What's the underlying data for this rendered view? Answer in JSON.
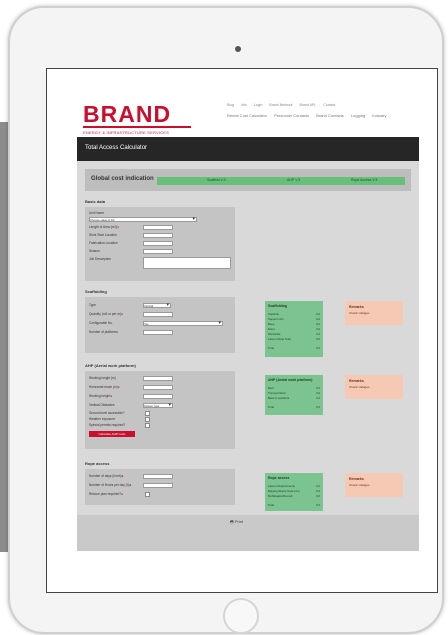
{
  "header": {
    "logo_text": "BRAND",
    "logo_sub": "ENERGY & INFRASTRUCTURE SERVICES",
    "top_links": [
      "Blog",
      "Info",
      "Login",
      "Brand Network",
      "Brand APL",
      "Contact"
    ],
    "main_nav": [
      "Rental Cost Calculator",
      "Personnel Contacts",
      "Brand Contacts",
      "Logging",
      "Industry"
    ]
  },
  "page": {
    "title": "Total Access Calculator",
    "print_label": "Print"
  },
  "cost_indication": {
    "title": "Global cost indication",
    "columns": [
      "Scaffold V.3",
      "AHP V.3",
      "Rope Access V.3"
    ]
  },
  "sections": {
    "basic": {
      "title": "Basic data",
      "fields": [
        "Unit Name",
        "Length of Area (m2)",
        "Work Start Location",
        "Fabrication Location",
        "Season",
        "Job Description"
      ],
      "select_value": "Choose value to list"
    },
    "scaffolding": {
      "title": "Scaffolding",
      "fields": [
        "Type",
        "Quantity (m3 or per m)",
        "Configurable No.",
        "Number of platforms"
      ],
      "select_values": [
        "Vertical",
        "Yes"
      ],
      "result_title": "Scaffolding",
      "result_rows": [
        "Capacity",
        "Support Unit",
        "Base",
        "Erect",
        "Dismantle",
        "Labour Reqs Total",
        "Total"
      ],
      "result_vals": [
        "0,0",
        "0,0",
        "0,0",
        "0,0",
        "0,0",
        "0,0",
        "0,0"
      ],
      "warning_title": "Remarks",
      "warning_text": "Check voltages"
    },
    "ahp": {
      "title": "AHP (Aerial work platform)",
      "fields": [
        "Working height (m)",
        "Horizontal reach (m)",
        "Working height",
        "Vertical Obstacles",
        "Ground level accessible?",
        "Weather exposure",
        "Special permits required?"
      ],
      "select_value": "Scissor type",
      "button_label": "Calculate AHP costs",
      "result_title": "AHP (Aerial work platform)",
      "result_rows": [
        "Rent",
        "Transportation",
        "Base in positions",
        "Total"
      ],
      "result_vals": [
        "0,0",
        "0,0",
        "0,0",
        "0,0"
      ],
      "warning_title": "Remarks",
      "warning_text": "Check voltages"
    },
    "rope": {
      "title": "Rope access",
      "fields": [
        "Number of days (h/mh)",
        "Number of Hours per day (h)",
        "Rescue plan required?"
      ],
      "result_title": "Rope access",
      "result_rows": [
        "Labour Requirements",
        "Rigging (Equip-Gear-Hrs)",
        "Mobilisation/Demob",
        "Total"
      ],
      "result_vals": [
        "0,0",
        "0,0",
        "0,0",
        "0,0"
      ],
      "warning_title": "Remarks",
      "warning_text": "Check voltages"
    }
  }
}
